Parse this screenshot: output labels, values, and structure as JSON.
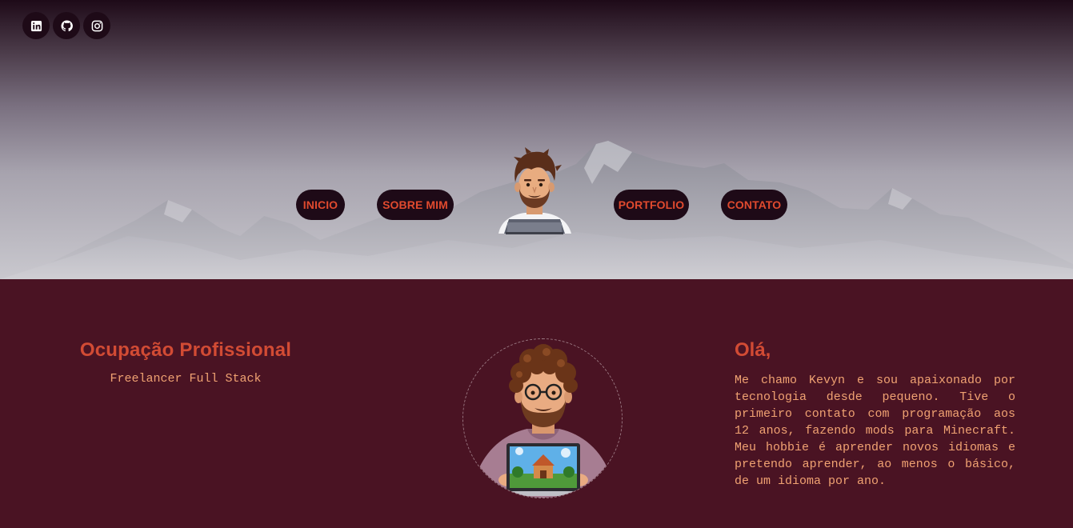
{
  "social": [
    {
      "name": "linkedin-icon"
    },
    {
      "name": "github-icon"
    },
    {
      "name": "instagram-icon"
    }
  ],
  "nav": {
    "inicio": "INICIO",
    "sobre": "SOBRE MIM",
    "portfolio": "PORTFOLIO",
    "contato": "CONTATO"
  },
  "occupation": {
    "title": "Ocupação Profissional",
    "subtitle": "Freelancer Full Stack"
  },
  "intro": {
    "greeting": "Olá,",
    "bio": "Me chamo Kevyn e sou apaixonado por tecnologia desde pequeno. Tive o primeiro contato com programação aos 12 anos, fazendo mods para Minecraft. Meu hobbie é aprender novos idiomas e pretendo aprender, ao menos o básico, de um idioma por ano."
  },
  "colors": {
    "background": "#4a1323",
    "accent": "#d24b34",
    "text": "#f0a272",
    "nav_bg": "#1e0a17",
    "nav_text": "#e04a2e"
  }
}
